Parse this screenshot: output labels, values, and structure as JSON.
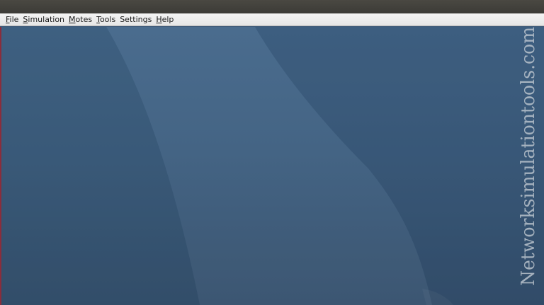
{
  "window": {
    "title": ""
  },
  "menubar": {
    "items": [
      {
        "mnemonic": "F",
        "rest": "ile"
      },
      {
        "mnemonic": "S",
        "rest": "imulation"
      },
      {
        "mnemonic": "M",
        "rest": "otes"
      },
      {
        "mnemonic": "T",
        "rest": "ools"
      },
      {
        "mnemonic": "",
        "rest": "Settings"
      },
      {
        "mnemonic": "H",
        "rest": "elp"
      }
    ]
  },
  "watermark": {
    "text": "Networksimulationtools.com"
  },
  "colors": {
    "titlebar": "#3c3b37",
    "menubar": "#ececec",
    "desktop": "#3e5f80",
    "accent_edge": "#8a2d3c"
  }
}
